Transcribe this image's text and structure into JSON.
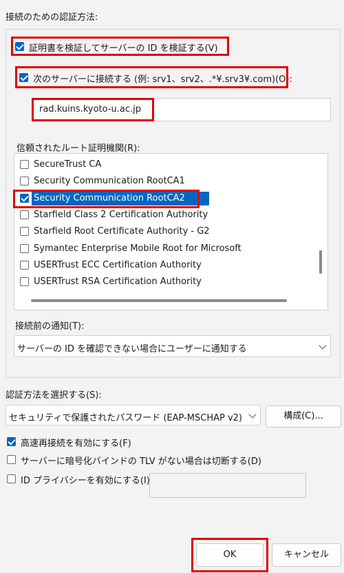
{
  "group_title": "接続のための認証方法:",
  "verify_cert": {
    "label": "証明書を検証してサーバーの ID を検証する(V)",
    "checked": true
  },
  "connect_servers": {
    "label": "次のサーバーに接続する (例: srv1、srv2、.*¥.srv3¥.com)(O):",
    "checked": true,
    "value": "rad.kuins.kyoto-u.ac.jp"
  },
  "root_ca": {
    "label": "信頼されたルート証明機関(R):",
    "items": [
      {
        "label": "SecureTrust CA",
        "checked": false
      },
      {
        "label": "Security Communication RootCA1",
        "checked": false
      },
      {
        "label": "Security Communication RootCA2",
        "checked": true,
        "selected": true
      },
      {
        "label": "Starfield Class 2 Certification Authority",
        "checked": false
      },
      {
        "label": "Starfield Root Certificate Authority - G2",
        "checked": false
      },
      {
        "label": "Symantec Enterprise Mobile Root for Microsoft",
        "checked": false
      },
      {
        "label": "USERTrust ECC Certification Authority",
        "checked": false
      },
      {
        "label": "USERTrust RSA Certification Authority",
        "checked": false
      }
    ]
  },
  "notify": {
    "label": "接続前の通知(T):",
    "value": "サーバーの ID を確認できない場合にユーザーに通知する"
  },
  "auth_method": {
    "label": "認証方法を選択する(S):",
    "value": "セキュリティで保護されたパスワード (EAP-MSCHAP v2)",
    "configure_label": "構成(C)..."
  },
  "fast_reconnect": {
    "label": "高速再接続を有効にする(F)",
    "checked": true
  },
  "disconnect_tlv": {
    "label": "サーバーに暗号化バインドの TLV がない場合は切断する(D)",
    "checked": false
  },
  "id_privacy": {
    "label": "ID プライバシーを有効にする(I)",
    "checked": false,
    "value": ""
  },
  "buttons": {
    "ok": "OK",
    "cancel": "キャンセル"
  },
  "colors": {
    "accent": "#0067c0",
    "highlight_box": "#e00000"
  }
}
